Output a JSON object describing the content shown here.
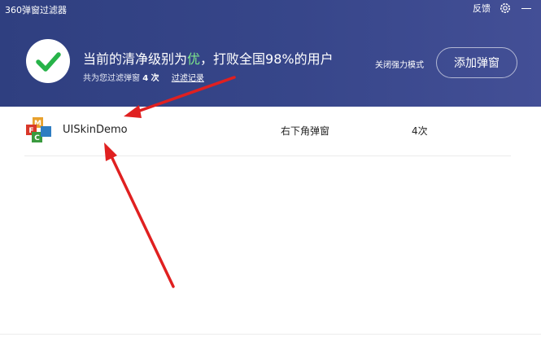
{
  "window": {
    "title": "360弹窗过滤器"
  },
  "topbar": {
    "feedback_label": "反馈",
    "icons": [
      "gear-icon",
      "minimize-icon"
    ]
  },
  "status": {
    "headline_prefix": "当前的清净级别为",
    "level": "优",
    "headline_suffix": "，打败全国98%的用户",
    "sub_prefix": "共为您过滤弹窗",
    "filtered_count": "4 次",
    "history_link": "过滤记录",
    "level_color": "#7ee88b"
  },
  "actions": {
    "strong_mode_label": "关闭强力模式",
    "add_popup_label": "添加弹窗"
  },
  "list": {
    "rows": [
      {
        "name": "UISkinDemo",
        "type": "右下角弹窗",
        "count": "4次",
        "icon": "mfc-app-icon"
      }
    ]
  },
  "colors": {
    "header_start": "#2f3f80",
    "header_end": "#434f96",
    "check_green": "#27b349",
    "arrow_red": "#e02020"
  }
}
